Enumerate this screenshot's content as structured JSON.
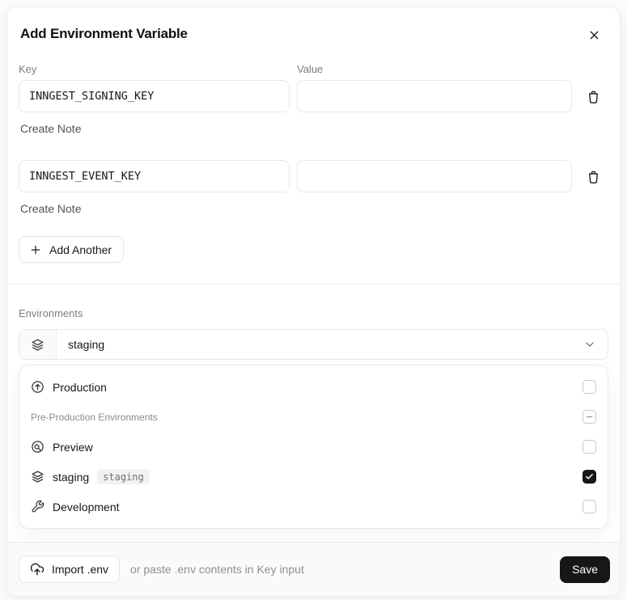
{
  "modal": {
    "title": "Add Environment Variable"
  },
  "form": {
    "key_label": "Key",
    "value_label": "Value",
    "rows": [
      {
        "key": "INNGEST_SIGNING_KEY",
        "value": "",
        "note_label": "Create Note"
      },
      {
        "key": "INNGEST_EVENT_KEY",
        "value": "",
        "note_label": "Create Note"
      }
    ],
    "add_another_label": "Add Another"
  },
  "environments": {
    "label": "Environments",
    "selected_value": "staging",
    "options": [
      {
        "label": "Production",
        "icon": "arrow-up-circle-icon",
        "state": "unchecked"
      },
      {
        "label": "Pre-Production Environments",
        "type": "group",
        "state": "indeterminate"
      },
      {
        "label": "Preview",
        "icon": "preview-icon",
        "state": "unchecked"
      },
      {
        "label": "staging",
        "badge": "staging",
        "icon": "layers-icon",
        "state": "checked"
      },
      {
        "label": "Development",
        "icon": "wrench-icon",
        "state": "unchecked"
      }
    ]
  },
  "footer": {
    "import_label": "Import .env",
    "hint": "or paste .env contents in Key input",
    "save_label": "Save"
  },
  "colors": {
    "accent_dark": "#171717",
    "border": "#e8e8e8",
    "muted_text": "#7d7d7d",
    "badge_bg": "#f2f2f2",
    "footer_bg": "#fafafa"
  }
}
